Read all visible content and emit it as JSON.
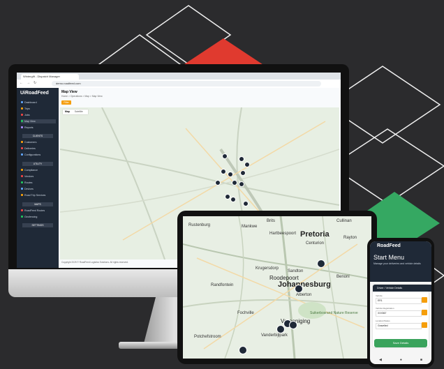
{
  "browser": {
    "tab_title": "Wintergift - Dispatch Manager",
    "url": "demo.roadfeed.com"
  },
  "app": {
    "logo": "UiRoadFeed",
    "sidebar": {
      "items_top": [
        "Dashboard",
        "Trips",
        "Jobs",
        "Map View",
        "Reports"
      ],
      "section_clients": "CLIENTS",
      "items_clients": [
        "Customers",
        "Deliveries",
        "Configurations"
      ],
      "section_utility": "UTILITY",
      "items_utility": [
        "Compliance",
        "Vendors",
        "Routes",
        "Devices",
        "Road Trip Services"
      ],
      "section_maps": "MAPS",
      "items_maps": [
        "RoadFeed Routes",
        "Geofencing"
      ],
      "section_settings": "SETTINGS"
    },
    "page": {
      "title": "Map View",
      "breadcrumb": "Home > Operations > Map > Map View",
      "button": "Filter",
      "map_toggle": [
        "Map",
        "Satellite"
      ],
      "footer": "Copyright 2025 © RoadFeed Logistics Solutions. All rights reserved."
    }
  },
  "tablet_map": {
    "labels": [
      "Rustenburg",
      "Mankwe",
      "Hartbeespoort",
      "Pretoria",
      "Centurion",
      "Krugersdorp",
      "Sandton",
      "Roodepoort",
      "Johannesburg",
      "Benoni",
      "Alberton",
      "Vereeniging",
      "Vanderbijlpark",
      "Potchefstroom",
      "Fochville",
      "Suikerbosrand Nature Reserve",
      "Brits",
      "Rayton",
      "Cullinan",
      "Randfontein"
    ]
  },
  "phone": {
    "logo": "RoadFeed",
    "title": "Start Menu",
    "subtitle": "Manage your deliveries and vehicle details",
    "card_title": "Driver / Vehicle Details",
    "fields": [
      {
        "label": "Vehicle",
        "value": "ER1"
      },
      {
        "label": "Vehicle Registration",
        "value": "XXX567"
      },
      {
        "label": "Location/Status",
        "value": "Gravelled"
      }
    ],
    "button": "Save Details",
    "nav": [
      "◀",
      "●",
      "■"
    ]
  },
  "colors": {
    "accent_orange": "#f59e0b",
    "accent_red": "#e03a2f",
    "accent_green": "#35a862",
    "dark": "#1f2937"
  }
}
